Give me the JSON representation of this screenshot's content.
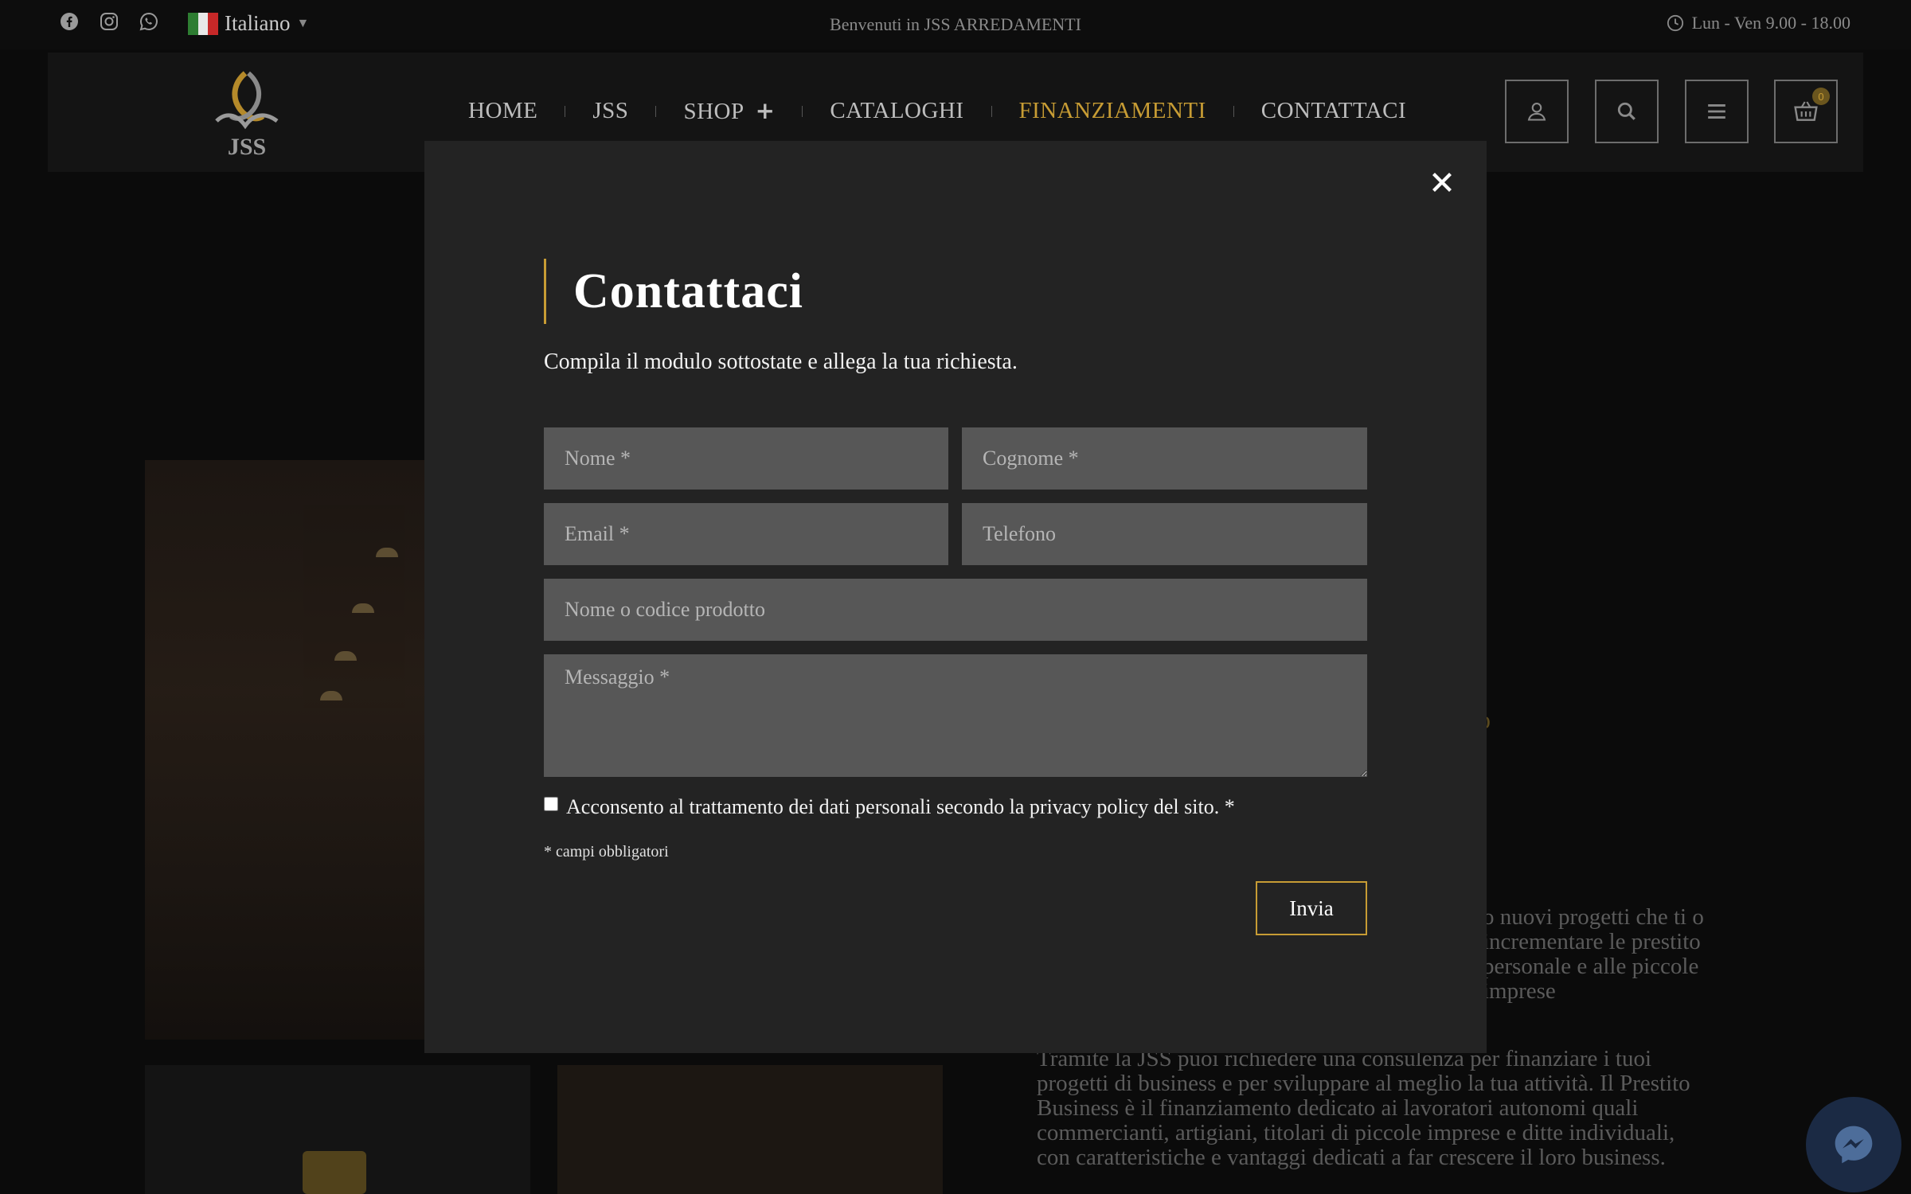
{
  "topbar": {
    "social_icons": [
      "facebook-icon",
      "instagram-icon",
      "whatsapp-icon"
    ],
    "language": "Italiano",
    "welcome": "Benvenuti in JSS ARREDAMENTI",
    "hours": "Lun - Ven 9.00 - 18.00"
  },
  "nav": {
    "logo_text": "JSS",
    "items": [
      "HOME",
      "JSS",
      "SHOP",
      "CATALOGHI",
      "FINANZIAMENTI",
      "CONTATTACI"
    ],
    "shop_toggle": "+",
    "active": "FINANZIAMENTI",
    "icons": [
      "user-icon",
      "search-icon",
      "menu-icon",
      "cart-icon"
    ],
    "cart_count": "0"
  },
  "background": {
    "heading_fragment": "o",
    "paragraph1": "o nuovi progetti che ti o incrementare le prestito personale e alle piccole imprese",
    "paragraph2": "Tramite la JSS puoi richiedere una consulenza per finanziare i tuoi progetti di business e per sviluppare al meglio la tua attività. Il Prestito Business è il finanziamento dedicato ai lavoratori autonomi quali commercianti, artigiani, titolari di piccole imprese e ditte individuali, con caratteristiche e vantaggi dedicati a far crescere il loro business."
  },
  "modal": {
    "title": "Contattaci",
    "subtitle": "Compila il modulo sottostate e allega la tua richiesta.",
    "fields": {
      "nome": "Nome *",
      "cognome": "Cognome *",
      "email": "Email *",
      "telefono": "Telefono",
      "prodotto": "Nome o codice prodotto",
      "messaggio": "Messaggio *"
    },
    "consent": "Acconsento al trattamento dei dati personali secondo la privacy policy del sito. *",
    "required_note": "* campi obbligatori",
    "submit": "Invia"
  },
  "colors": {
    "accent": "#c79c34",
    "modal_bg": "#232323",
    "field_bg": "#575757"
  }
}
